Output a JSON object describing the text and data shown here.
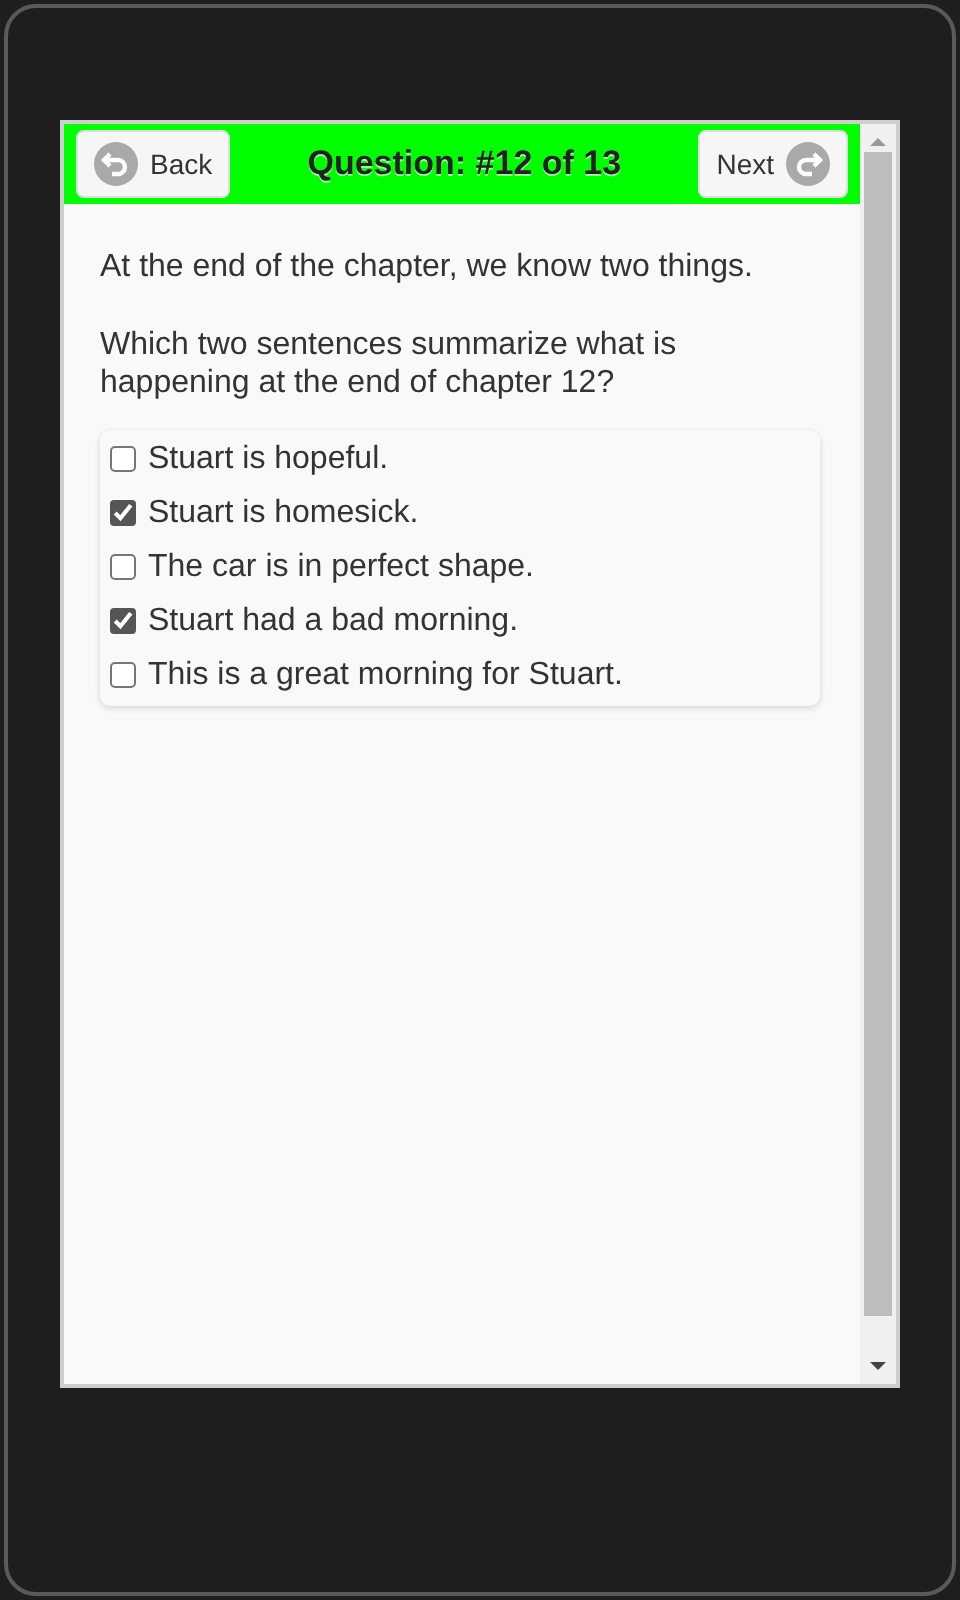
{
  "header": {
    "back": "Back",
    "title": "Question: #12 of 13",
    "next": "Next"
  },
  "question": [
    "At the end of the chapter, we know two things.",
    "Which two sentences summarize what is happening at the end of chapter 12?"
  ],
  "options": [
    {
      "label": "Stuart is hopeful.",
      "checked": false
    },
    {
      "label": "Stuart is homesick.",
      "checked": true
    },
    {
      "label": "The car is in perfect shape.",
      "checked": false
    },
    {
      "label": "Stuart had a bad morning.",
      "checked": true
    },
    {
      "label": "This is a great morning for Stuart.",
      "checked": false
    }
  ]
}
